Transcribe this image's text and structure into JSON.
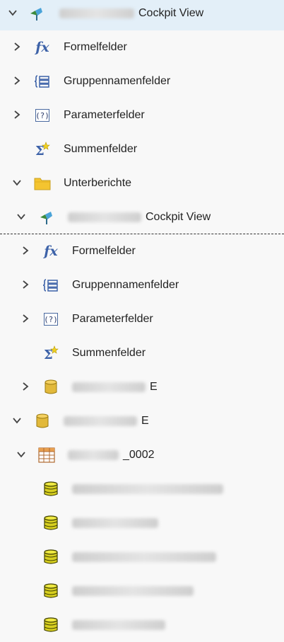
{
  "colors": {
    "selected_bg": "#e3eff8",
    "icon_blue": "#3d62a8",
    "folder_yellow": "#f4c430",
    "db_yellow": "#e2b93b"
  },
  "rows": [
    {
      "label": "Cockpit View"
    },
    {
      "label": "Formelfelder"
    },
    {
      "label": "Gruppennamenfelder"
    },
    {
      "label": "Parameterfelder"
    },
    {
      "label": "Summenfelder"
    },
    {
      "label": "Unterberichte"
    },
    {
      "label": "Cockpit View"
    },
    {
      "label": "Formelfelder"
    },
    {
      "label": "Gruppennamenfelder"
    },
    {
      "label": "Parameterfelder"
    },
    {
      "label": "Summenfelder"
    },
    {
      "label": "E"
    },
    {
      "label": "E"
    },
    {
      "label": "_0002"
    },
    {
      "label": ""
    },
    {
      "label": ""
    },
    {
      "label": ""
    },
    {
      "label": ""
    },
    {
      "label": ""
    }
  ]
}
